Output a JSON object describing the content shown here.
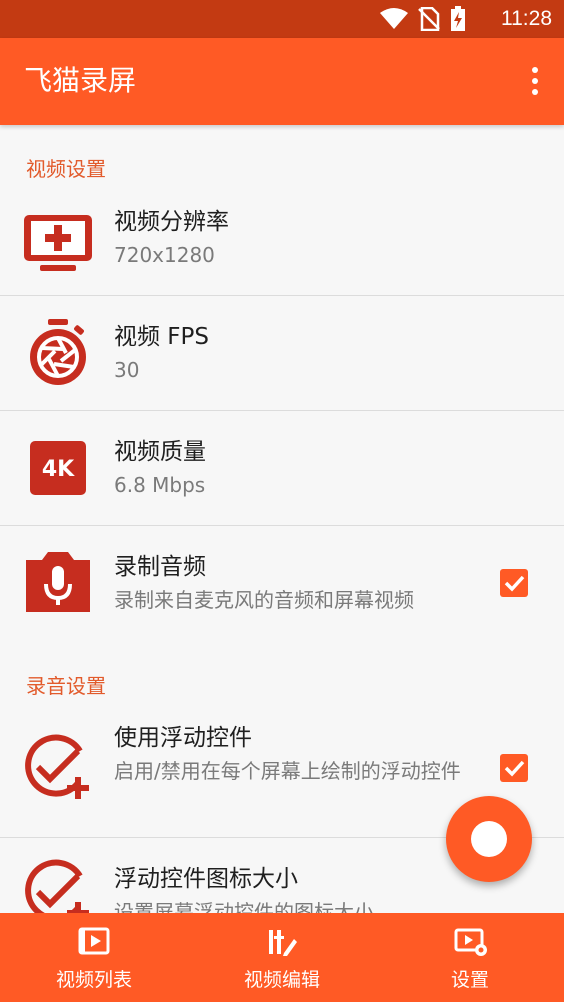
{
  "status_bar": {
    "time": "11:28"
  },
  "app_bar": {
    "title": "飞猫录屏",
    "menu_icon": "more-vert-icon"
  },
  "sections": {
    "video": {
      "header": "视频设置",
      "resolution": {
        "title": "视频分辨率",
        "value": "720x1280",
        "icon": "monitor-plus-icon"
      },
      "fps": {
        "title": "视频 FPS",
        "value": "30",
        "icon": "stopwatch-shutter-icon"
      },
      "quality": {
        "title": "视频质量",
        "value": "6.8 Mbps",
        "icon": "4k-icon"
      },
      "audio": {
        "title": "录制音频",
        "value": "录制来自麦克风的音频和屏幕视频",
        "icon": "microphone-icon",
        "checked": true
      }
    },
    "recording": {
      "header": "录音设置",
      "floating": {
        "title": "使用浮动控件",
        "value": "启用/禁用在每个屏幕上绘制的浮动控件",
        "icon": "check-plus-icon",
        "checked": true
      },
      "floating_size": {
        "title": "浮动控件图标大小",
        "value": "设置屏幕浮动控件的图标大小",
        "icon": "check-plus-icon"
      }
    }
  },
  "bottom_nav": {
    "items": [
      {
        "label": "视频列表",
        "icon": "video-list-icon"
      },
      {
        "label": "视频编辑",
        "icon": "video-edit-icon"
      },
      {
        "label": "设置",
        "icon": "settings-video-icon"
      }
    ]
  },
  "colors": {
    "accent": "#ff5a25",
    "status_bar": "#c33a12",
    "icon_red": "#c62d1f",
    "section_header": "#e25b2c"
  }
}
